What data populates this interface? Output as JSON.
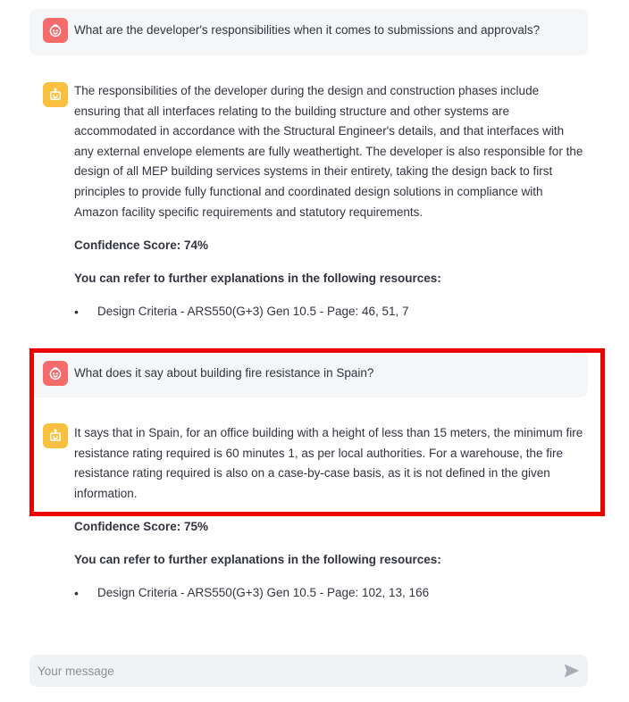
{
  "messages": [
    {
      "role": "user",
      "text": "What are the developer's responsibilities when it comes to submissions and approvals?"
    },
    {
      "role": "assistant",
      "text": "The responsibilities of the developer during the design and construction phases include ensuring that all interfaces relating to the building structure and other systems are accommodated in accordance with the Structural Engineer's details, and that interfaces with any external envelope elements are fully weathertight. The developer is also responsible for the design of all MEP building services systems in their entirety, taking the design back to first principles to provide fully functional and coordinated design solutions in compliance with Amazon facility specific requirements and statutory requirements.",
      "confidence": "Confidence Score: 74%",
      "resources_heading": "You can refer to further explanations in the following resources:",
      "resources": [
        "Design Criteria - ARS550(G+3) Gen 10.5 - Page: 46, 51, 7"
      ]
    },
    {
      "role": "user",
      "text": "What does it say about building fire resistance in Spain?"
    },
    {
      "role": "assistant",
      "text": "It says that in Spain, for an office building with a height of less than 15 meters, the minimum fire resistance rating required is 60 minutes 1, as per local authorities. For a warehouse, the fire resistance rating required is also on a case-by-case basis, as it is not defined in the given information.",
      "confidence": "Confidence Score: 75%",
      "resources_heading": "You can refer to further explanations in the following resources:",
      "resources": [
        "Design Criteria - ARS550(G+3) Gen 10.5 - Page: 102, 13, 166"
      ]
    }
  ],
  "chat_input": {
    "placeholder": "Your message",
    "value": ""
  },
  "icons": {
    "user_avatar": "user-face-icon",
    "assistant_avatar": "robot-icon",
    "send": "send-arrow-icon"
  },
  "colors": {
    "user_avatar": "#f36b6b",
    "assistant_avatar": "#f9c040",
    "highlight": "#ee0000",
    "user_bubble": "#f5f6f8"
  }
}
